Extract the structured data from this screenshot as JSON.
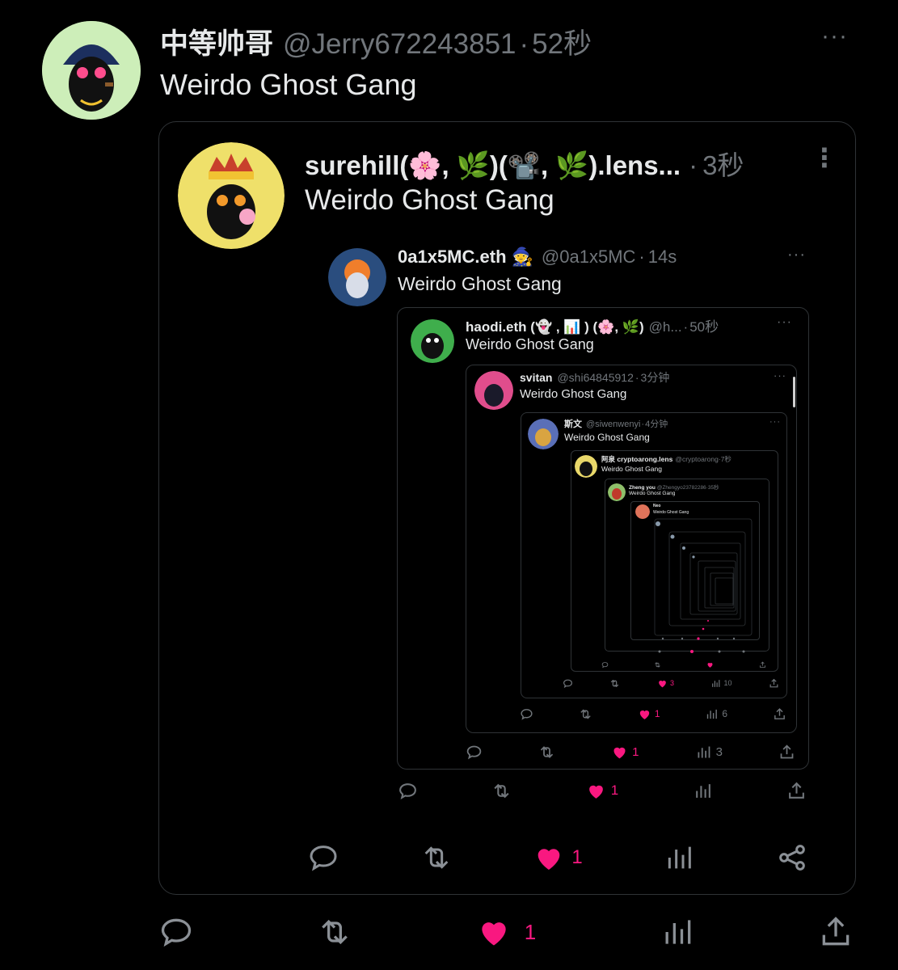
{
  "level0": {
    "display_name": "中等帅哥",
    "handle": "@Jerry672243851",
    "dot": "·",
    "time": "52秒",
    "text": "Weirdo Ghost Gang",
    "more": "···",
    "actions": {
      "like_count": "1"
    }
  },
  "level1": {
    "display_name": "surehill(🌸, 🌿)(📽️, 🌿).lens...",
    "dot": "·",
    "time": "3秒",
    "text": "Weirdo Ghost Gang",
    "more": "⋮",
    "actions": {
      "like_count": "1"
    }
  },
  "level2": {
    "display_name": "0a1x5MC.eth",
    "handle": "@0a1x5MC",
    "dot": "·",
    "time": "14s",
    "text": "Weirdo Ghost Gang",
    "more": "···",
    "actions": {
      "like_count": "1"
    }
  },
  "level3": {
    "display_name": "haodi.eth (👻 , 📊 ) (🌸, 🌿)",
    "handle": "@h...",
    "dot": "·",
    "time": "50秒",
    "text": "Weirdo Ghost Gang",
    "more": "···",
    "actions": {
      "like_count": "1",
      "view_count": "3"
    }
  },
  "level4": {
    "display_name": "svitan",
    "handle": "@shi64845912",
    "dot": "·",
    "time": "3分钟",
    "text": "Weirdo Ghost Gang",
    "more": "···",
    "actions": {
      "like_count": "1",
      "view_count": "6"
    }
  },
  "level5": {
    "display_name": "斯文",
    "handle": "@siwenwenyi",
    "dot": "·",
    "time": "4分钟",
    "text": "Weirdo Ghost Gang",
    "more": "···",
    "actions": {
      "like_count": "3",
      "view_count": "10"
    }
  },
  "level6": {
    "display_name": "阿泉 cryptoarong.lens",
    "handle": "@cryptoarong",
    "dot": "·",
    "time": "7秒",
    "text": "Weirdo Ghost Gang"
  },
  "level7": {
    "display_name": "Zheng you",
    "handle": "@Zhengyo23782286",
    "dot": "·",
    "time": "35秒",
    "text": "Weirdo Ghost Gang"
  },
  "level8": {
    "display_name": "Neo",
    "text": "Weirdo Ghost Gang"
  },
  "colors": {
    "background": "#000000",
    "like": "#f91880",
    "muted": "#71767b",
    "text": "#e7e9ea",
    "border": "#2f3336"
  }
}
